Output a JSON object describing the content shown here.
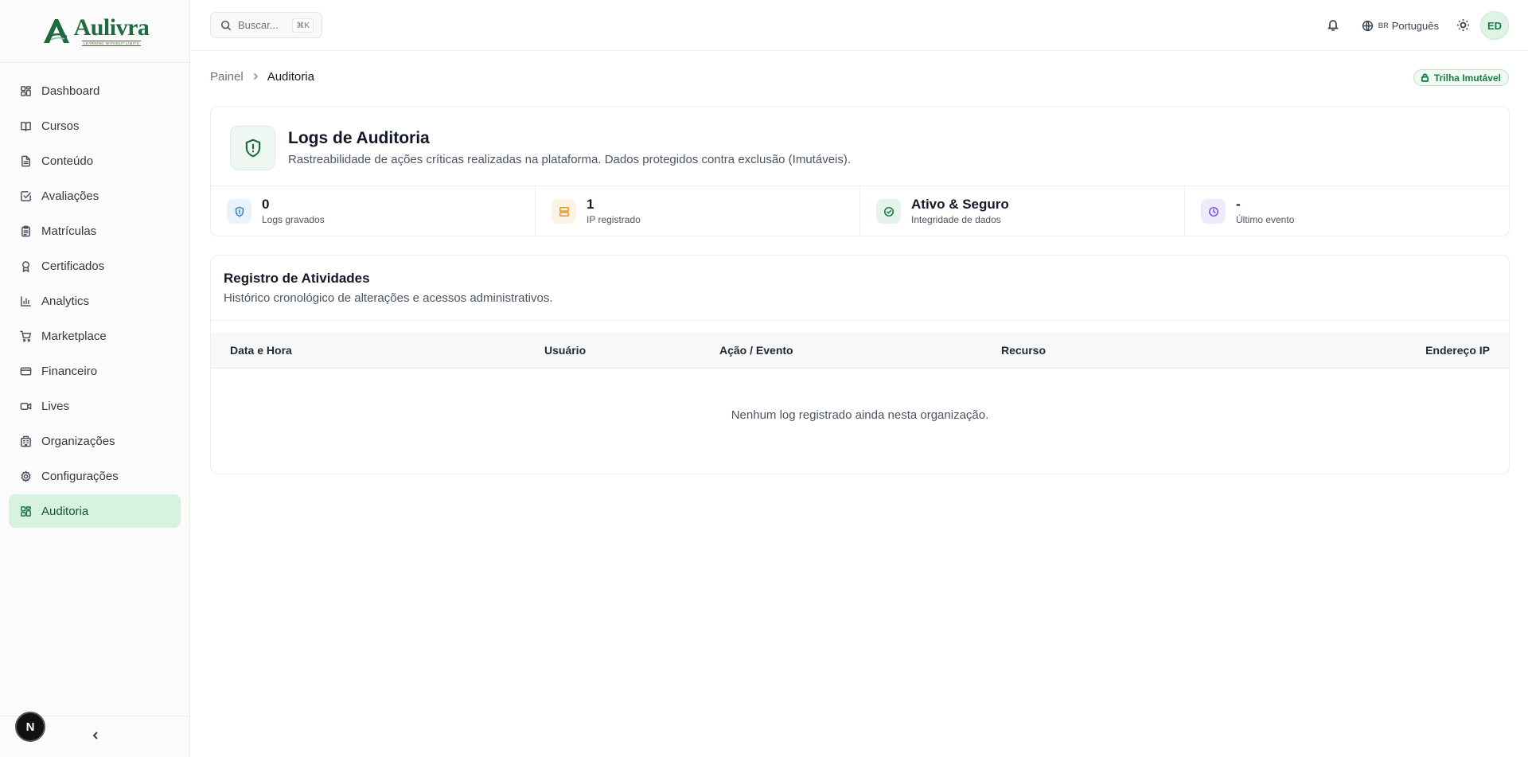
{
  "brand": {
    "name": "Aulivra",
    "tagline": "LEARNING WITHOUT LIMITS"
  },
  "sidebar": {
    "items": [
      {
        "label": "Dashboard",
        "icon": "dashboard-grid-icon"
      },
      {
        "label": "Cursos",
        "icon": "book-open-icon"
      },
      {
        "label": "Conteúdo",
        "icon": "file-text-icon"
      },
      {
        "label": "Avaliações",
        "icon": "check-square-icon"
      },
      {
        "label": "Matrículas",
        "icon": "clipboard-icon"
      },
      {
        "label": "Certificados",
        "icon": "award-icon"
      },
      {
        "label": "Analytics",
        "icon": "bar-chart-icon"
      },
      {
        "label": "Marketplace",
        "icon": "shopping-cart-icon"
      },
      {
        "label": "Financeiro",
        "icon": "credit-card-icon"
      },
      {
        "label": "Lives",
        "icon": "video-icon"
      },
      {
        "label": "Organizações",
        "icon": "building-icon"
      },
      {
        "label": "Configurações",
        "icon": "gear-icon"
      },
      {
        "label": "Auditoria",
        "icon": "audit-grid-icon",
        "active": true
      }
    ],
    "badge": "N"
  },
  "topbar": {
    "search_placeholder": "Buscar...",
    "shortcut": "⌘K",
    "language_flag": "BR",
    "language": "Português",
    "avatar_initials": "ED"
  },
  "breadcrumb": {
    "parent": "Painel",
    "current": "Auditoria"
  },
  "trail_badge": "Trilha Imutável",
  "header": {
    "title": "Logs de Auditoria",
    "subtitle": "Rastreabilidade de ações críticas realizadas na plataforma. Dados protegidos contra exclusão (Imutáveis)."
  },
  "stats": [
    {
      "value": "0",
      "label": "Logs gravados",
      "icon": "shield-icon",
      "color": "#3b82c4"
    },
    {
      "value": "1",
      "label": "IP registrado",
      "icon": "server-icon",
      "color": "#e0962a"
    },
    {
      "value": "Ativo & Seguro",
      "label": "Integridade de dados",
      "icon": "check-circle-icon",
      "color": "#1f7a45"
    },
    {
      "value": "-",
      "label": "Último evento",
      "icon": "clock-icon",
      "color": "#7c5bd6"
    }
  ],
  "activity": {
    "title": "Registro de Atividades",
    "subtitle": "Histórico cronológico de alterações e acessos administrativos.",
    "columns": [
      "Data e Hora",
      "Usuário",
      "Ação / Evento",
      "Recurso",
      "Endereço IP"
    ],
    "empty_message": "Nenhum log registrado ainda nesta organização."
  },
  "colors": {
    "accent": "#1f7a45",
    "active_bg": "#d7f2e1"
  }
}
